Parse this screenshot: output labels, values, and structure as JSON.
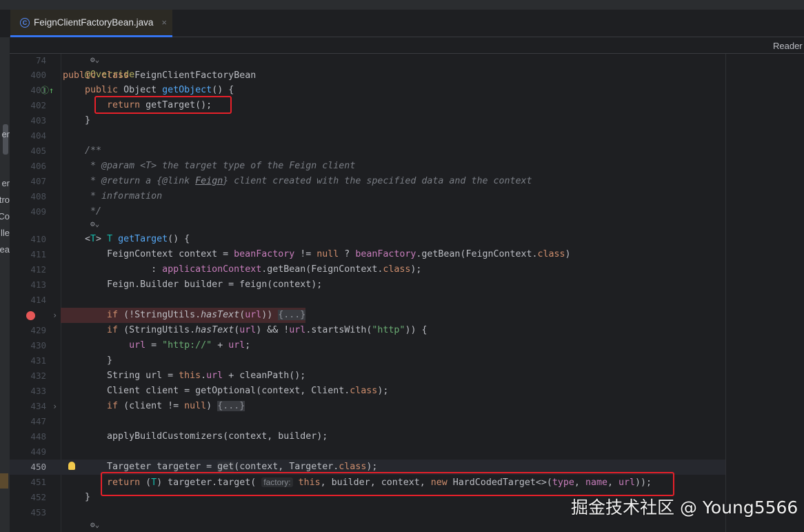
{
  "tab": {
    "icon": "class-icon",
    "icon_letter": "C",
    "title": "FeignClientFactoryBean.java",
    "close": "×"
  },
  "reader_mode": "Reader",
  "left_panel_fragments": [
    "er",
    "er",
    "tro",
    "Co",
    "lle",
    "ea"
  ],
  "sticky_header": {
    "num": "74",
    "tokens": [
      [
        "public ",
        "k"
      ],
      [
        "class ",
        "k"
      ],
      [
        "FeignClientFactoryBean",
        ""
      ]
    ]
  },
  "lines": [
    {
      "inlay": "⚙⌄"
    },
    {
      "num": "400",
      "tokens": [
        [
          "    ",
          ""
        ],
        [
          "@Override",
          "a"
        ]
      ]
    },
    {
      "num": "401",
      "impl": "Ⓘ↑",
      "tokens": [
        [
          "    ",
          ""
        ],
        [
          "public ",
          "k"
        ],
        [
          "Object ",
          ""
        ],
        [
          "getObject",
          "m"
        ],
        [
          "() {",
          ""
        ]
      ]
    },
    {
      "num": "402",
      "tokens": [
        [
          "        ",
          ""
        ],
        [
          "return ",
          "k"
        ],
        [
          "getTarget();",
          ""
        ]
      ]
    },
    {
      "num": "403",
      "tokens": [
        [
          "    }",
          ""
        ]
      ]
    },
    {
      "num": "404",
      "tokens": []
    },
    {
      "num": "405",
      "tokens": [
        [
          "    ",
          ""
        ],
        [
          "/**",
          "c"
        ]
      ]
    },
    {
      "num": "406",
      "tokens": [
        [
          "     * ",
          "c"
        ],
        [
          "@param ",
          "ct"
        ],
        [
          "<T>",
          "ct"
        ],
        [
          " the target type of the Feign client",
          "c"
        ]
      ]
    },
    {
      "num": "407",
      "tokens": [
        [
          "     * ",
          "c"
        ],
        [
          "@return ",
          "ct"
        ],
        [
          "a {",
          "c"
        ],
        [
          "@link ",
          "ct"
        ],
        [
          "Feign",
          "cb"
        ],
        [
          "} client created with the specified data and the context",
          "c"
        ]
      ]
    },
    {
      "num": "408",
      "tokens": [
        [
          "     * information",
          "c"
        ]
      ]
    },
    {
      "num": "409",
      "tokens": [
        [
          "     */",
          "c"
        ]
      ]
    },
    {
      "inlay": "⚙⌄"
    },
    {
      "num": "410",
      "tokens": [
        [
          "    <",
          ""
        ],
        [
          "T",
          "tp"
        ],
        [
          "> ",
          ""
        ],
        [
          "T ",
          "tp"
        ],
        [
          "getTarget",
          "m"
        ],
        [
          "() {",
          ""
        ]
      ]
    },
    {
      "num": "411",
      "tokens": [
        [
          "        FeignContext context = ",
          ""
        ],
        [
          "beanFactory",
          "f"
        ],
        [
          " != ",
          ""
        ],
        [
          "null",
          "k"
        ],
        [
          " ? ",
          ""
        ],
        [
          "beanFactory",
          "f"
        ],
        [
          ".getBean(FeignContext.",
          ""
        ],
        [
          "class",
          "k"
        ],
        [
          ")",
          ""
        ]
      ]
    },
    {
      "num": "412",
      "tokens": [
        [
          "                : ",
          ""
        ],
        [
          "applicationContext",
          "f"
        ],
        [
          ".getBean(FeignContext.",
          ""
        ],
        [
          "class",
          "k"
        ],
        [
          ");",
          ""
        ]
      ]
    },
    {
      "num": "413",
      "tokens": [
        [
          "        Feign.Builder builder = feign(context);",
          ""
        ]
      ]
    },
    {
      "num": "414",
      "tokens": []
    },
    {
      "breakpoint": true,
      "fold": true,
      "tokens": [
        [
          "        ",
          ""
        ],
        [
          "if ",
          "k"
        ],
        [
          "(!StringUtils.",
          ""
        ],
        [
          "hasText",
          "i"
        ],
        [
          "(",
          ""
        ],
        [
          "url",
          "f"
        ],
        [
          ")) ",
          ""
        ],
        [
          "{...}",
          "fb"
        ]
      ]
    },
    {
      "num": "429",
      "tokens": [
        [
          "        ",
          ""
        ],
        [
          "if ",
          "k"
        ],
        [
          "(StringUtils.",
          ""
        ],
        [
          "hasText",
          "i"
        ],
        [
          "(",
          ""
        ],
        [
          "url",
          "f"
        ],
        [
          ") && !",
          ""
        ],
        [
          "url",
          "f"
        ],
        [
          ".startsWith(",
          ""
        ],
        [
          "\"http\"",
          "s"
        ],
        [
          ")) {",
          ""
        ]
      ]
    },
    {
      "num": "430",
      "tokens": [
        [
          "            ",
          ""
        ],
        [
          "url",
          "f"
        ],
        [
          " = ",
          ""
        ],
        [
          "\"http://\"",
          "s"
        ],
        [
          " + ",
          ""
        ],
        [
          "url",
          "f"
        ],
        [
          ";",
          ""
        ]
      ]
    },
    {
      "num": "431",
      "tokens": [
        [
          "        }",
          ""
        ]
      ]
    },
    {
      "num": "432",
      "tokens": [
        [
          "        String url = ",
          ""
        ],
        [
          "this",
          "k"
        ],
        [
          ".",
          ""
        ],
        [
          "url",
          "f"
        ],
        [
          " + cleanPath();",
          ""
        ]
      ]
    },
    {
      "num": "433",
      "tokens": [
        [
          "        Client client = getOptional(context, Client.",
          ""
        ],
        [
          "class",
          "k"
        ],
        [
          ");",
          ""
        ]
      ]
    },
    {
      "num": "434",
      "fold": true,
      "tokens": [
        [
          "        ",
          ""
        ],
        [
          "if ",
          "k"
        ],
        [
          "(client != ",
          ""
        ],
        [
          "null",
          "k"
        ],
        [
          ") ",
          ""
        ],
        [
          "{...}",
          "fb"
        ]
      ]
    },
    {
      "num": "447",
      "tokens": []
    },
    {
      "num": "448",
      "tokens": [
        [
          "        applyBuildCustomizers(context, builder);",
          ""
        ]
      ]
    },
    {
      "num": "449",
      "tokens": []
    },
    {
      "num": "450",
      "current": true,
      "bulb": true,
      "tokens": [
        [
          "        Targeter targeter = ",
          ""
        ],
        [
          "get",
          "gt"
        ],
        [
          "(context, Targeter.",
          ""
        ],
        [
          "class",
          "k"
        ],
        [
          ");",
          ""
        ]
      ]
    },
    {
      "num": "451",
      "tokens": [
        [
          "        ",
          ""
        ],
        [
          "return ",
          "k"
        ],
        [
          "(",
          ""
        ],
        [
          "T",
          "tp"
        ],
        [
          ") targeter.target( ",
          ""
        ],
        [
          "factory:",
          "hint"
        ],
        [
          " ",
          ""
        ],
        [
          "this",
          "k"
        ],
        [
          ", builder, context, ",
          ""
        ],
        [
          "new ",
          "k"
        ],
        [
          "HardCodedTarget<>(",
          ""
        ],
        [
          "type",
          "f"
        ],
        [
          ", ",
          ""
        ],
        [
          "name",
          "f"
        ],
        [
          ", ",
          ""
        ],
        [
          "url",
          "f"
        ],
        [
          "));",
          ""
        ]
      ]
    },
    {
      "num": "452",
      "tokens": [
        [
          "    }",
          ""
        ]
      ]
    },
    {
      "num": "453",
      "tokens": []
    },
    {
      "inlay": "⚙⌄"
    }
  ],
  "watermark": "掘金技术社区 @ Young5566"
}
